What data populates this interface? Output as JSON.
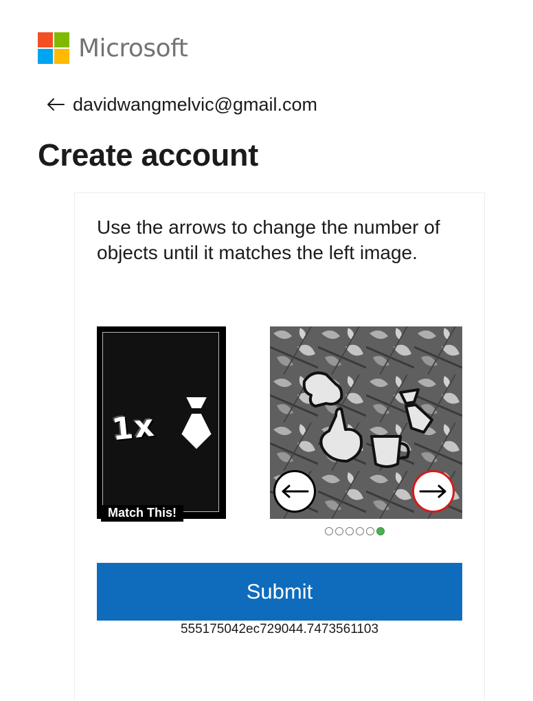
{
  "brand": {
    "name": "Microsoft",
    "colors": [
      "#f25022",
      "#7fba00",
      "#00a4ef",
      "#ffb900"
    ]
  },
  "identity": {
    "email": "davidwangmelvic@gmail.com",
    "back_icon": "arrow-left-icon"
  },
  "page": {
    "title": "Create account"
  },
  "challenge": {
    "instructions": "Use the arrows to change the number of objects until it matches the left image.",
    "target": {
      "count_text": "1x",
      "object_icon": "tie-icon",
      "label": "Match This!"
    },
    "puzzle": {
      "prev_icon": "arrow-left-icon",
      "next_icon": "arrow-right-icon",
      "pages_total": 6,
      "current_page": 6
    },
    "submit_label": "Submit",
    "session_id": "555175042ec729044.7473561103"
  },
  "accent": {
    "submit_bg": "#0f6cbd",
    "active_dot": "#4caf50",
    "next_button_border": "#d61a1a"
  }
}
